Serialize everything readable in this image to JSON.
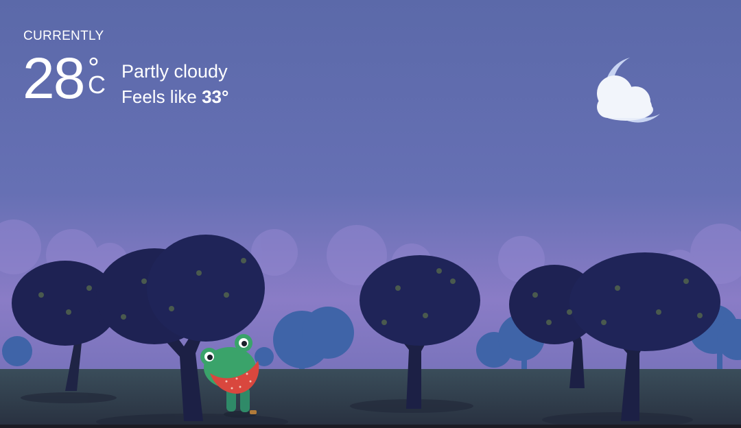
{
  "weather": {
    "label": "CURRENTLY",
    "temperature": "28",
    "degree_symbol": "°",
    "unit": "C",
    "condition": "Partly cloudy",
    "feels_like_prefix": "Feels like",
    "feels_like_value": "33°"
  },
  "icons": {
    "condition_icon": "moon-with-cloud-icon",
    "mascot": "frog-mascot"
  },
  "colors": {
    "sky_top": "#5e6aa8",
    "sky_bottom": "#8978c2",
    "ground": "#2c3a4a",
    "tree": "#1c2150"
  }
}
